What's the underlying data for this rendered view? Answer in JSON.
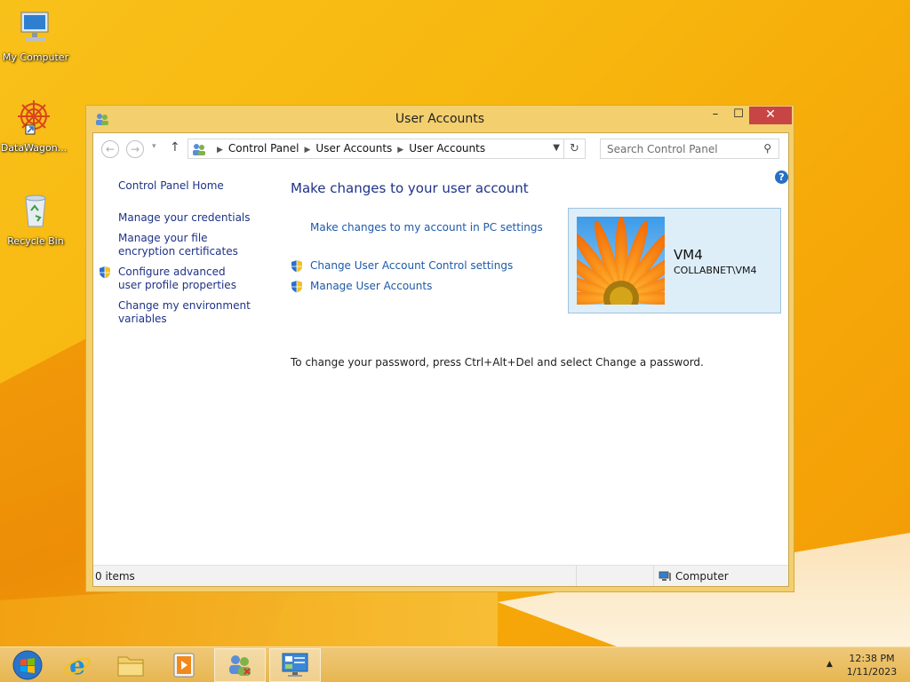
{
  "desktop": {
    "icons": [
      {
        "label": "My Computer",
        "icon": "computer-icon"
      },
      {
        "label": "DataWagon...",
        "icon": "datawagon-icon"
      },
      {
        "label": "Recycle Bin",
        "icon": "recycle-bin-icon"
      }
    ]
  },
  "window": {
    "title": "User Accounts",
    "controls": {
      "minimize": "–",
      "maximize": "☐",
      "close": "✕"
    },
    "address": {
      "crumbs": [
        "Control Panel",
        "User Accounts",
        "User Accounts"
      ]
    },
    "search": {
      "placeholder": "Search Control Panel"
    },
    "left_pane": {
      "links": [
        {
          "label": "Control Panel Home",
          "shield": false
        },
        {
          "label": "Manage your credentials",
          "shield": false
        },
        {
          "label": "Manage your file encryption certificates",
          "shield": false
        },
        {
          "label": "Configure advanced user profile properties",
          "shield": true
        },
        {
          "label": "Change my environment variables",
          "shield": false
        }
      ]
    },
    "main": {
      "heading": "Make changes to your user account",
      "links": {
        "pc_settings": "Make changes to my account in PC settings",
        "uac": "Change User Account Control settings",
        "manage": "Manage User Accounts"
      },
      "note": "To change your password, press Ctrl+Alt+Del and select Change a password."
    },
    "account": {
      "name": "VM4",
      "domain": "COLLABNET\\VM4"
    },
    "status": {
      "items": "0 items",
      "zone": "Computer"
    }
  },
  "taskbar": {
    "apps": [
      "start-button",
      "internet-explorer",
      "file-explorer",
      "media-player",
      "user-accounts",
      "control-panel"
    ],
    "clock": {
      "time": "12:38 PM",
      "date": "1/11/2023"
    }
  },
  "colors": {
    "link": "#1e3287",
    "accent": "#2a6fc6",
    "close": "#c74545",
    "window_frame": "#f3cf6e"
  }
}
